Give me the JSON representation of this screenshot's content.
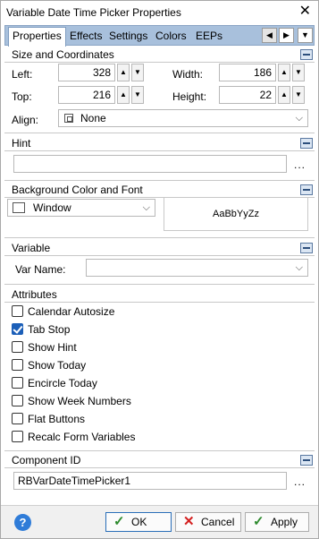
{
  "window": {
    "title": "Variable Date Time Picker Properties",
    "close": "✕"
  },
  "tabs": [
    {
      "label": "Properties",
      "active": true
    },
    {
      "label": "Effects"
    },
    {
      "label": "Settings"
    },
    {
      "label": "Colors"
    },
    {
      "label": "EEPs"
    }
  ],
  "tab_nav": {
    "prev": "◀",
    "next": "▶",
    "menu": "▼"
  },
  "size": {
    "title": "Size and Coordinates",
    "left_label": "Left:",
    "left_value": "328",
    "top_label": "Top:",
    "top_value": "216",
    "width_label": "Width:",
    "width_value": "186",
    "height_label": "Height:",
    "height_value": "22",
    "align_label": "Align:",
    "align_value": "None"
  },
  "hint": {
    "title": "Hint",
    "value": "",
    "browse": "..."
  },
  "background": {
    "title": "Background Color and Font",
    "color_value": "Window",
    "preview_text": "AaBbYyZz"
  },
  "variable": {
    "title": "Variable",
    "var_name_label": "Var Name:",
    "var_name_value": ""
  },
  "attributes": {
    "title": "Attributes",
    "items": [
      {
        "label": "Calendar Autosize",
        "checked": false
      },
      {
        "label": "Tab Stop",
        "checked": true
      },
      {
        "label": "Show Hint",
        "checked": false
      },
      {
        "label": "Show Today",
        "checked": false
      },
      {
        "label": "Encircle Today",
        "checked": false
      },
      {
        "label": "Show Week Numbers",
        "checked": false
      },
      {
        "label": "Flat Buttons",
        "checked": false
      },
      {
        "label": "Recalc Form Variables",
        "checked": false
      }
    ]
  },
  "component": {
    "title": "Component ID",
    "value": "RBVarDateTimePicker1",
    "browse": "..."
  },
  "buttons": {
    "help": "?",
    "ok": "OK",
    "cancel": "Cancel",
    "apply": "Apply"
  },
  "colors": {
    "tab_bar": "#a8c0dc",
    "check_on": "#1c5fb8",
    "help_icon": "#2f7cd8",
    "ok_check": "#2e8b2e",
    "cancel_x": "#d42020"
  }
}
